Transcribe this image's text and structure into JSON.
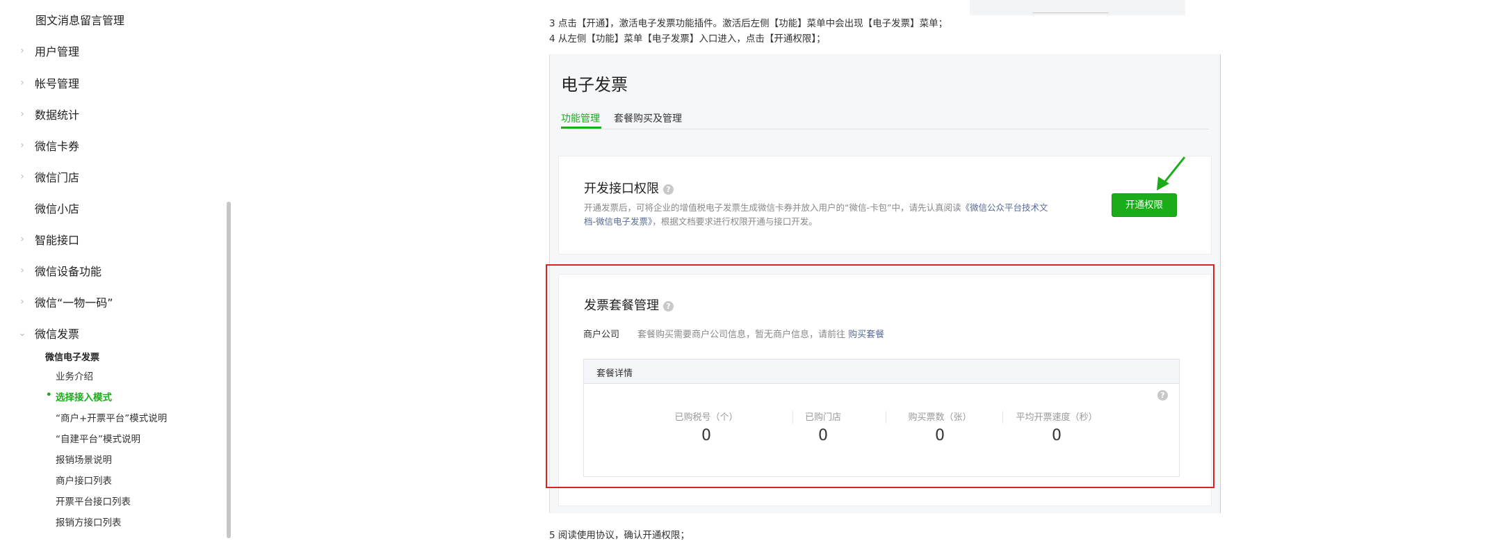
{
  "sidebar": {
    "top_item": "图文消息留言管理",
    "items": [
      {
        "label": "用户管理",
        "chevron": "chevron-right"
      },
      {
        "label": "帐号管理",
        "chevron": "chevron-right"
      },
      {
        "label": "数据统计",
        "chevron": "chevron-right"
      },
      {
        "label": "微信卡券",
        "chevron": "chevron-right"
      },
      {
        "label": "微信门店",
        "chevron": "chevron-right"
      },
      {
        "label": "微信小店",
        "chevron": ""
      },
      {
        "label": "智能接口",
        "chevron": "chevron-right"
      },
      {
        "label": "微信设备功能",
        "chevron": "chevron-right"
      },
      {
        "label": "微信“一物一码”",
        "chevron": "chevron-right"
      },
      {
        "label": "微信发票",
        "chevron": "chevron-down"
      }
    ],
    "sub_title": "微信电子发票",
    "sub_items": [
      {
        "label": "业务介绍",
        "active": false
      },
      {
        "label": "选择接入模式",
        "active": true
      },
      {
        "label": "“商户+开票平台”模式说明",
        "active": false
      },
      {
        "label": "“自建平台”模式说明",
        "active": false
      },
      {
        "label": "报销场景说明",
        "active": false
      },
      {
        "label": "商户接口列表",
        "active": false
      },
      {
        "label": "开票平台接口列表",
        "active": false
      },
      {
        "label": "报销方接口列表",
        "active": false
      }
    ]
  },
  "content": {
    "step3": "3 点击【开通】，激活电子发票功能插件。激活后左侧【功能】菜单中会出现【电子发票】菜单；",
    "step4": "4 从左侧【功能】菜单【电子发票】入口进入，点击【开通权限】；",
    "step5": "5 阅读使用协议，确认开通权限；",
    "screenshot": {
      "title": "电子发票",
      "tabs": [
        {
          "label": "功能管理",
          "active": true
        },
        {
          "label": "套餐购买及管理",
          "active": false
        }
      ],
      "api_card": {
        "title": "开发接口权限",
        "desc_line1": "开通发票后，可将企业的增值税电子发票生成微信卡券并放入用户的“微信-卡包”中，请先认真阅读",
        "doc_link_part1": "《微信公众平台技术文",
        "doc_link_part2": "档-微信电子发票》",
        "desc_tail": "，根据文档要求进行权限开通与接口开发。",
        "button": "开通权限"
      },
      "package_card": {
        "title": "发票套餐管理",
        "merchant_label": "商户公司",
        "merchant_text": "套餐购买需要商户公司信息，暂无商户信息，请前往",
        "merchant_link": "购买套餐",
        "detail_header": "套餐详情",
        "stats": [
          {
            "label": "已购税号（个）",
            "value": "0"
          },
          {
            "label": "已购门店",
            "value": "0"
          },
          {
            "label": "购买票数（张）",
            "value": "0"
          },
          {
            "label": "平均开票速度（秒）",
            "value": "0"
          }
        ]
      }
    },
    "highlight_color": "#e02020",
    "accent_color": "#1aad19"
  }
}
